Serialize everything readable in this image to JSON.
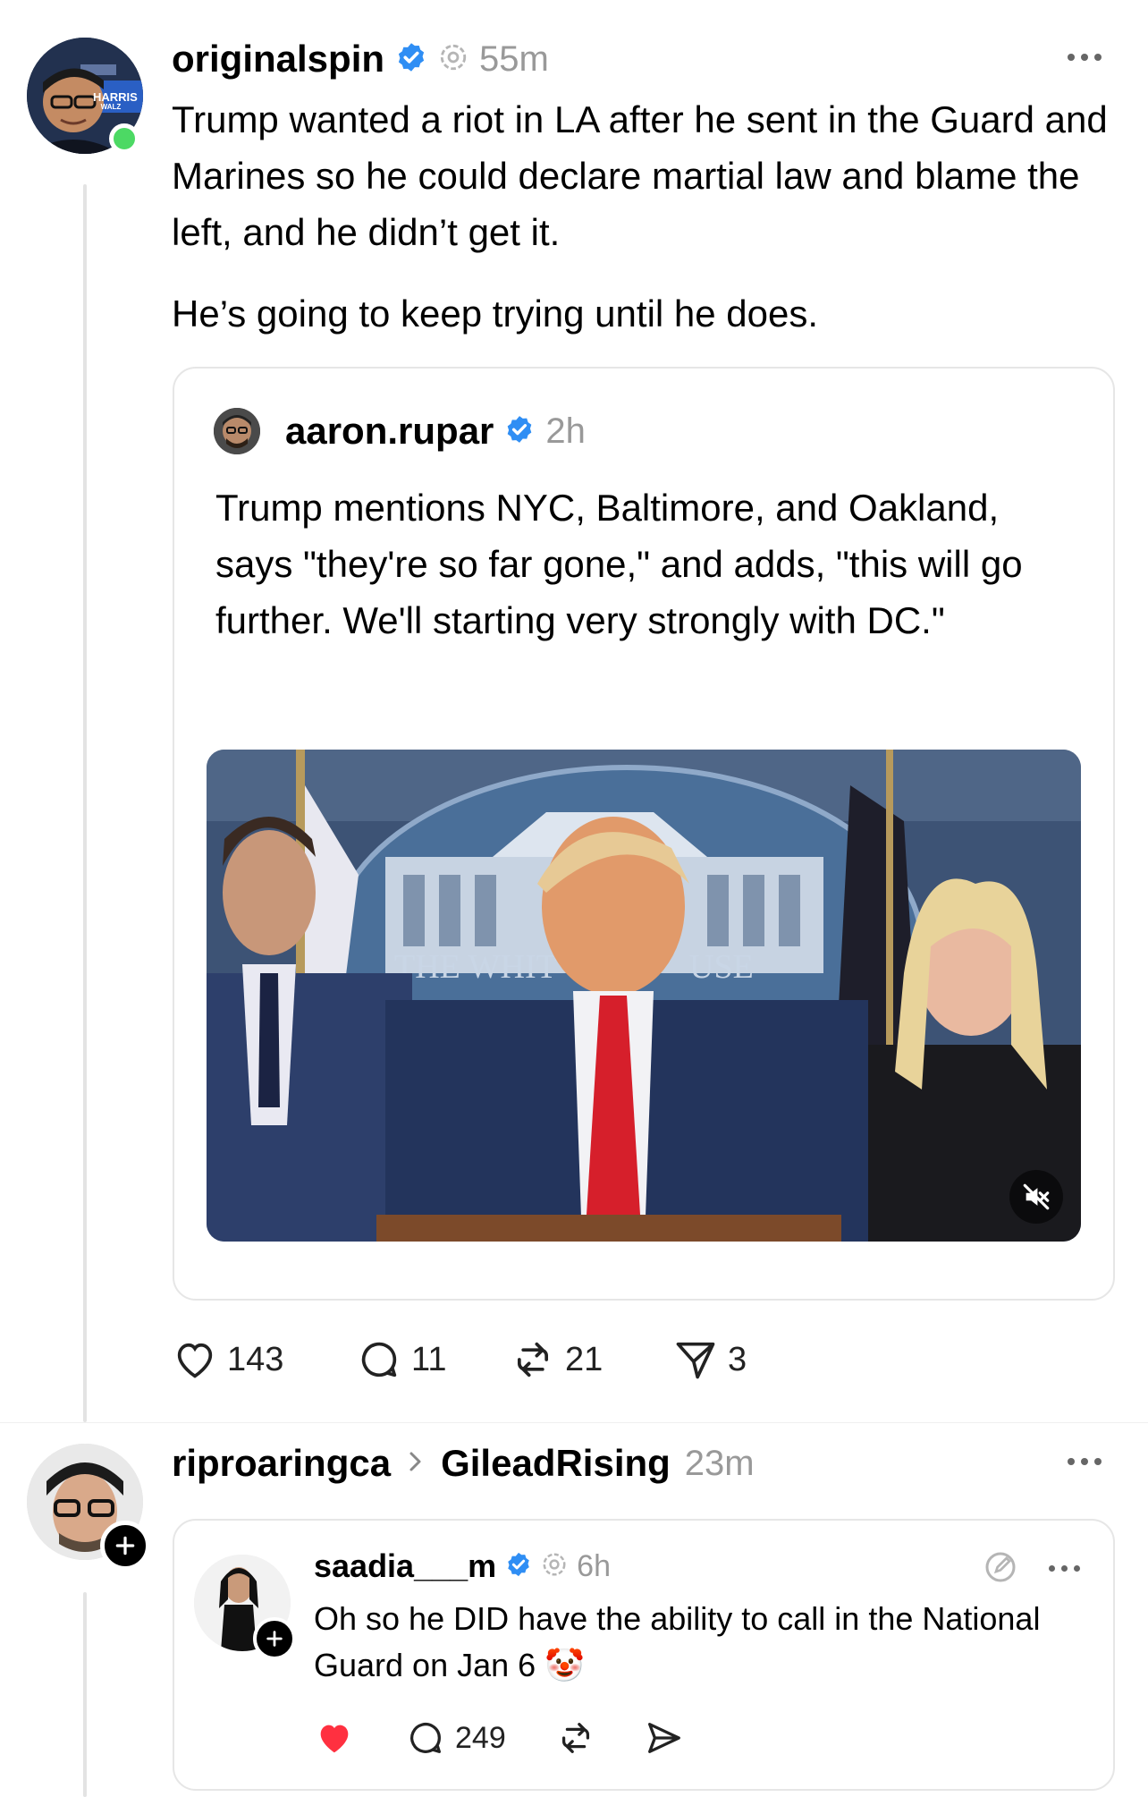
{
  "post1": {
    "username": "originalspin",
    "time": "55m",
    "paragraphs": [
      "Trump wanted a riot in LA after he sent in the Guard and Marines so he could declare martial law and blame the left, and he didn’t get it.",
      "He’s going to keep trying until he does."
    ],
    "avatar_badge": "HARRIS",
    "avatar_badge_sub": "WALZ",
    "quote": {
      "username": "aaron.rupar",
      "time": "2h",
      "text": "Trump mentions NYC, Baltimore, and Oakland, says \"they're so far gone,\" and adds, \"this will go further. We'll starting very strongly with DC.\"",
      "media_sign_left": "THE WHIT",
      "media_sign_right": "USE"
    },
    "actions": {
      "likes": "143",
      "replies": "11",
      "reposts": "21",
      "shares": "3"
    }
  },
  "post2": {
    "username": "riproaringca",
    "community": "GileadRising",
    "time": "23m",
    "quote": {
      "username": "saadia___m",
      "time": "6h",
      "text": "Oh so he DID have the ability to call in the National Guard on Jan 6 🤡",
      "actions": {
        "replies": "249"
      }
    }
  },
  "colors": {
    "verified": "#2f8ef4",
    "online": "#4cd964",
    "like_red": "#ff3040",
    "text_muted": "#999999"
  }
}
